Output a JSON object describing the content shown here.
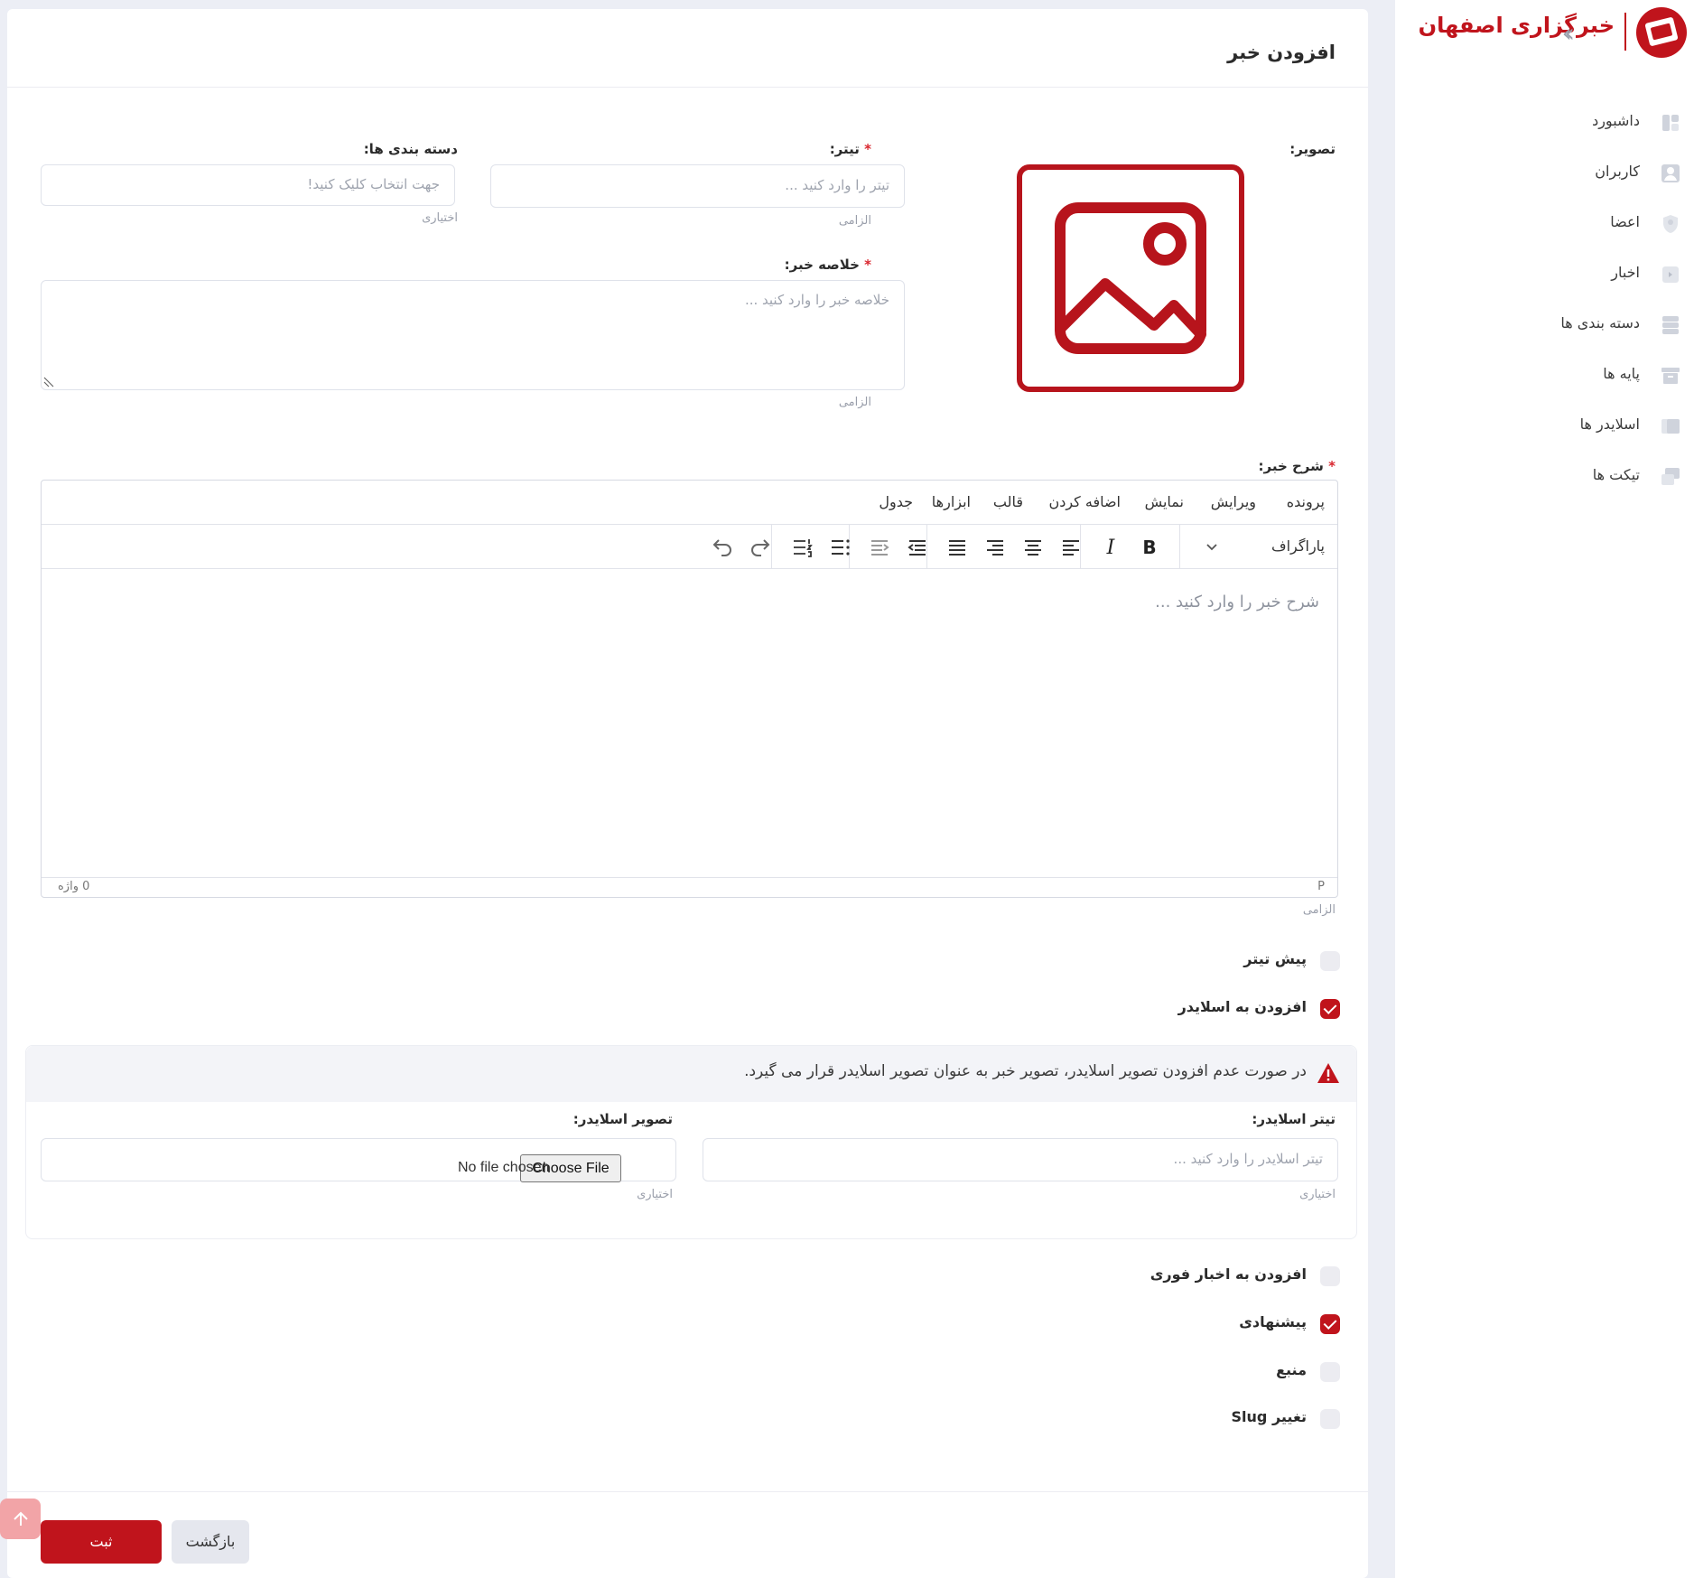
{
  "sidebar": {
    "brand": "خبرگزاری اصفهان",
    "collapse_icon": "chevrons-left-icon",
    "items": [
      {
        "label": "داشبورد",
        "icon": "dashboard-icon"
      },
      {
        "label": "کاربران",
        "icon": "user-icon"
      },
      {
        "label": "اعضا",
        "icon": "members-icon"
      },
      {
        "label": "اخبار",
        "icon": "news-icon"
      },
      {
        "label": "دسته بندی ها",
        "icon": "categories-icon"
      },
      {
        "label": "پایه ها",
        "icon": "archive-icon"
      },
      {
        "label": "اسلایدر ها",
        "icon": "slider-icon"
      },
      {
        "label": "تیکت ها",
        "icon": "tickets-icon"
      }
    ]
  },
  "page": {
    "title": "افزودن خبر"
  },
  "form": {
    "image_label": "تصویر:",
    "title_label": "تیتر:",
    "title_placeholder": "تیتر را وارد کنید ...",
    "title_hint": "الزامی",
    "categories_label": "دسته بندی ها:",
    "categories_placeholder": "جهت انتخاب کلیک کنید!",
    "categories_hint": "اختیاری",
    "summary_label": "خلاصه خبر:",
    "summary_placeholder": "خلاصه خبر را وارد کنید ...",
    "summary_hint": "الزامی",
    "body_label": "شرح خبر:",
    "body_placeholder": "شرح خبر را وارد کنید ...",
    "body_hint": "الزامی",
    "required_mark": "*"
  },
  "editor": {
    "menu": [
      "پرونده",
      "ویرایش",
      "نمایش",
      "اضافه کردن",
      "قالب",
      "ابزارها",
      "جدول"
    ],
    "block_format": "پاراگراف",
    "status_path": "P",
    "word_count": "0 واژه"
  },
  "options": {
    "pre_title": {
      "label": "پیش تیتر",
      "checked": false
    },
    "add_to_slider": {
      "label": "افزودن به اسلایدر",
      "checked": true
    },
    "breaking": {
      "label": "افزودن به اخبار فوری",
      "checked": false
    },
    "suggested": {
      "label": "پیشنهادی",
      "checked": true
    },
    "source": {
      "label": "منبع",
      "checked": false
    },
    "change_slug": {
      "label": "تغییر Slug",
      "checked": false
    }
  },
  "slider": {
    "alert": "در صورت عدم افزودن تصویر اسلایدر، تصویر خبر به عنوان تصویر اسلایدر قرار می گیرد.",
    "title_label": "تیتر اسلایدر:",
    "title_placeholder": "تیتر اسلایدر را وارد کنید ...",
    "title_hint": "اختیاری",
    "image_label": "تصویر اسلایدر:",
    "choose_file": "Choose File",
    "no_file": "No file chosen",
    "image_hint": "اختیاری"
  },
  "actions": {
    "submit": "ثبت",
    "back": "بازگشت"
  },
  "colors": {
    "accent": "#c0141c",
    "background": "#eceef5"
  }
}
